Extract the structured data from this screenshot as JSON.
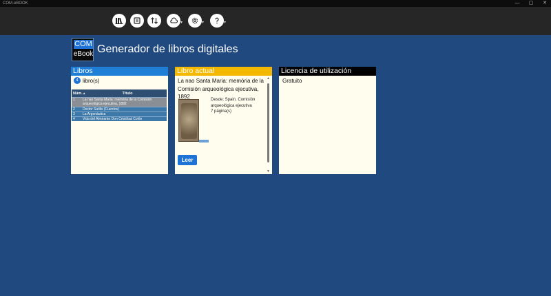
{
  "window": {
    "title": "COM-eBOOK",
    "minimize": "—",
    "maximize": "▢",
    "close": "✕"
  },
  "toolbar": {
    "items": [
      {
        "icon": "library-icon"
      },
      {
        "icon": "sync-books-icon"
      },
      {
        "icon": "sort-arrows-icon"
      },
      {
        "icon": "cloud-icon",
        "dropdown": "▾"
      },
      {
        "icon": "settings-icon",
        "dropdown": "▾"
      },
      {
        "icon": "help-icon",
        "dropdown": "▾"
      }
    ]
  },
  "header": {
    "logo_top": "COM",
    "logo_bottom": "eBook",
    "title": "Generador de libros digitales"
  },
  "libros": {
    "heading": "Libros",
    "count": "4",
    "count_label": "libro(s)",
    "columns": {
      "num": "Núm.",
      "sort": "▲",
      "title": "Título"
    },
    "rows": [
      {
        "num": "1",
        "title": "La nao Santa Maria: memória de la Comisión arqueológica ejecutiva, 1892",
        "selected": true
      },
      {
        "num": "2",
        "title": "Doctor Sutilis (Cuentos)",
        "selected": false
      },
      {
        "num": "3",
        "title": "La Argonáutica",
        "selected": false
      },
      {
        "num": "4",
        "title": "Vida del Almirante Don Cristóbal Colón",
        "selected": false
      }
    ]
  },
  "actual": {
    "heading": "Libro actual",
    "title": "La nao Santa Maria: memória de la Comisión arqueológica ejecutiva, 1892",
    "desde": "Desde: Spain. Comisión arqueológica ejecutiva",
    "paginas": "7 página(s)",
    "read_button": "Leer"
  },
  "licencia": {
    "heading": "Licencia de utilización",
    "value": "Gratuito"
  },
  "colors": {
    "background": "#204a7f",
    "libros_header": "#1f7fd6",
    "actual_header": "#f5b800",
    "licencia_header": "#000000",
    "accent": "#1f73d6"
  }
}
